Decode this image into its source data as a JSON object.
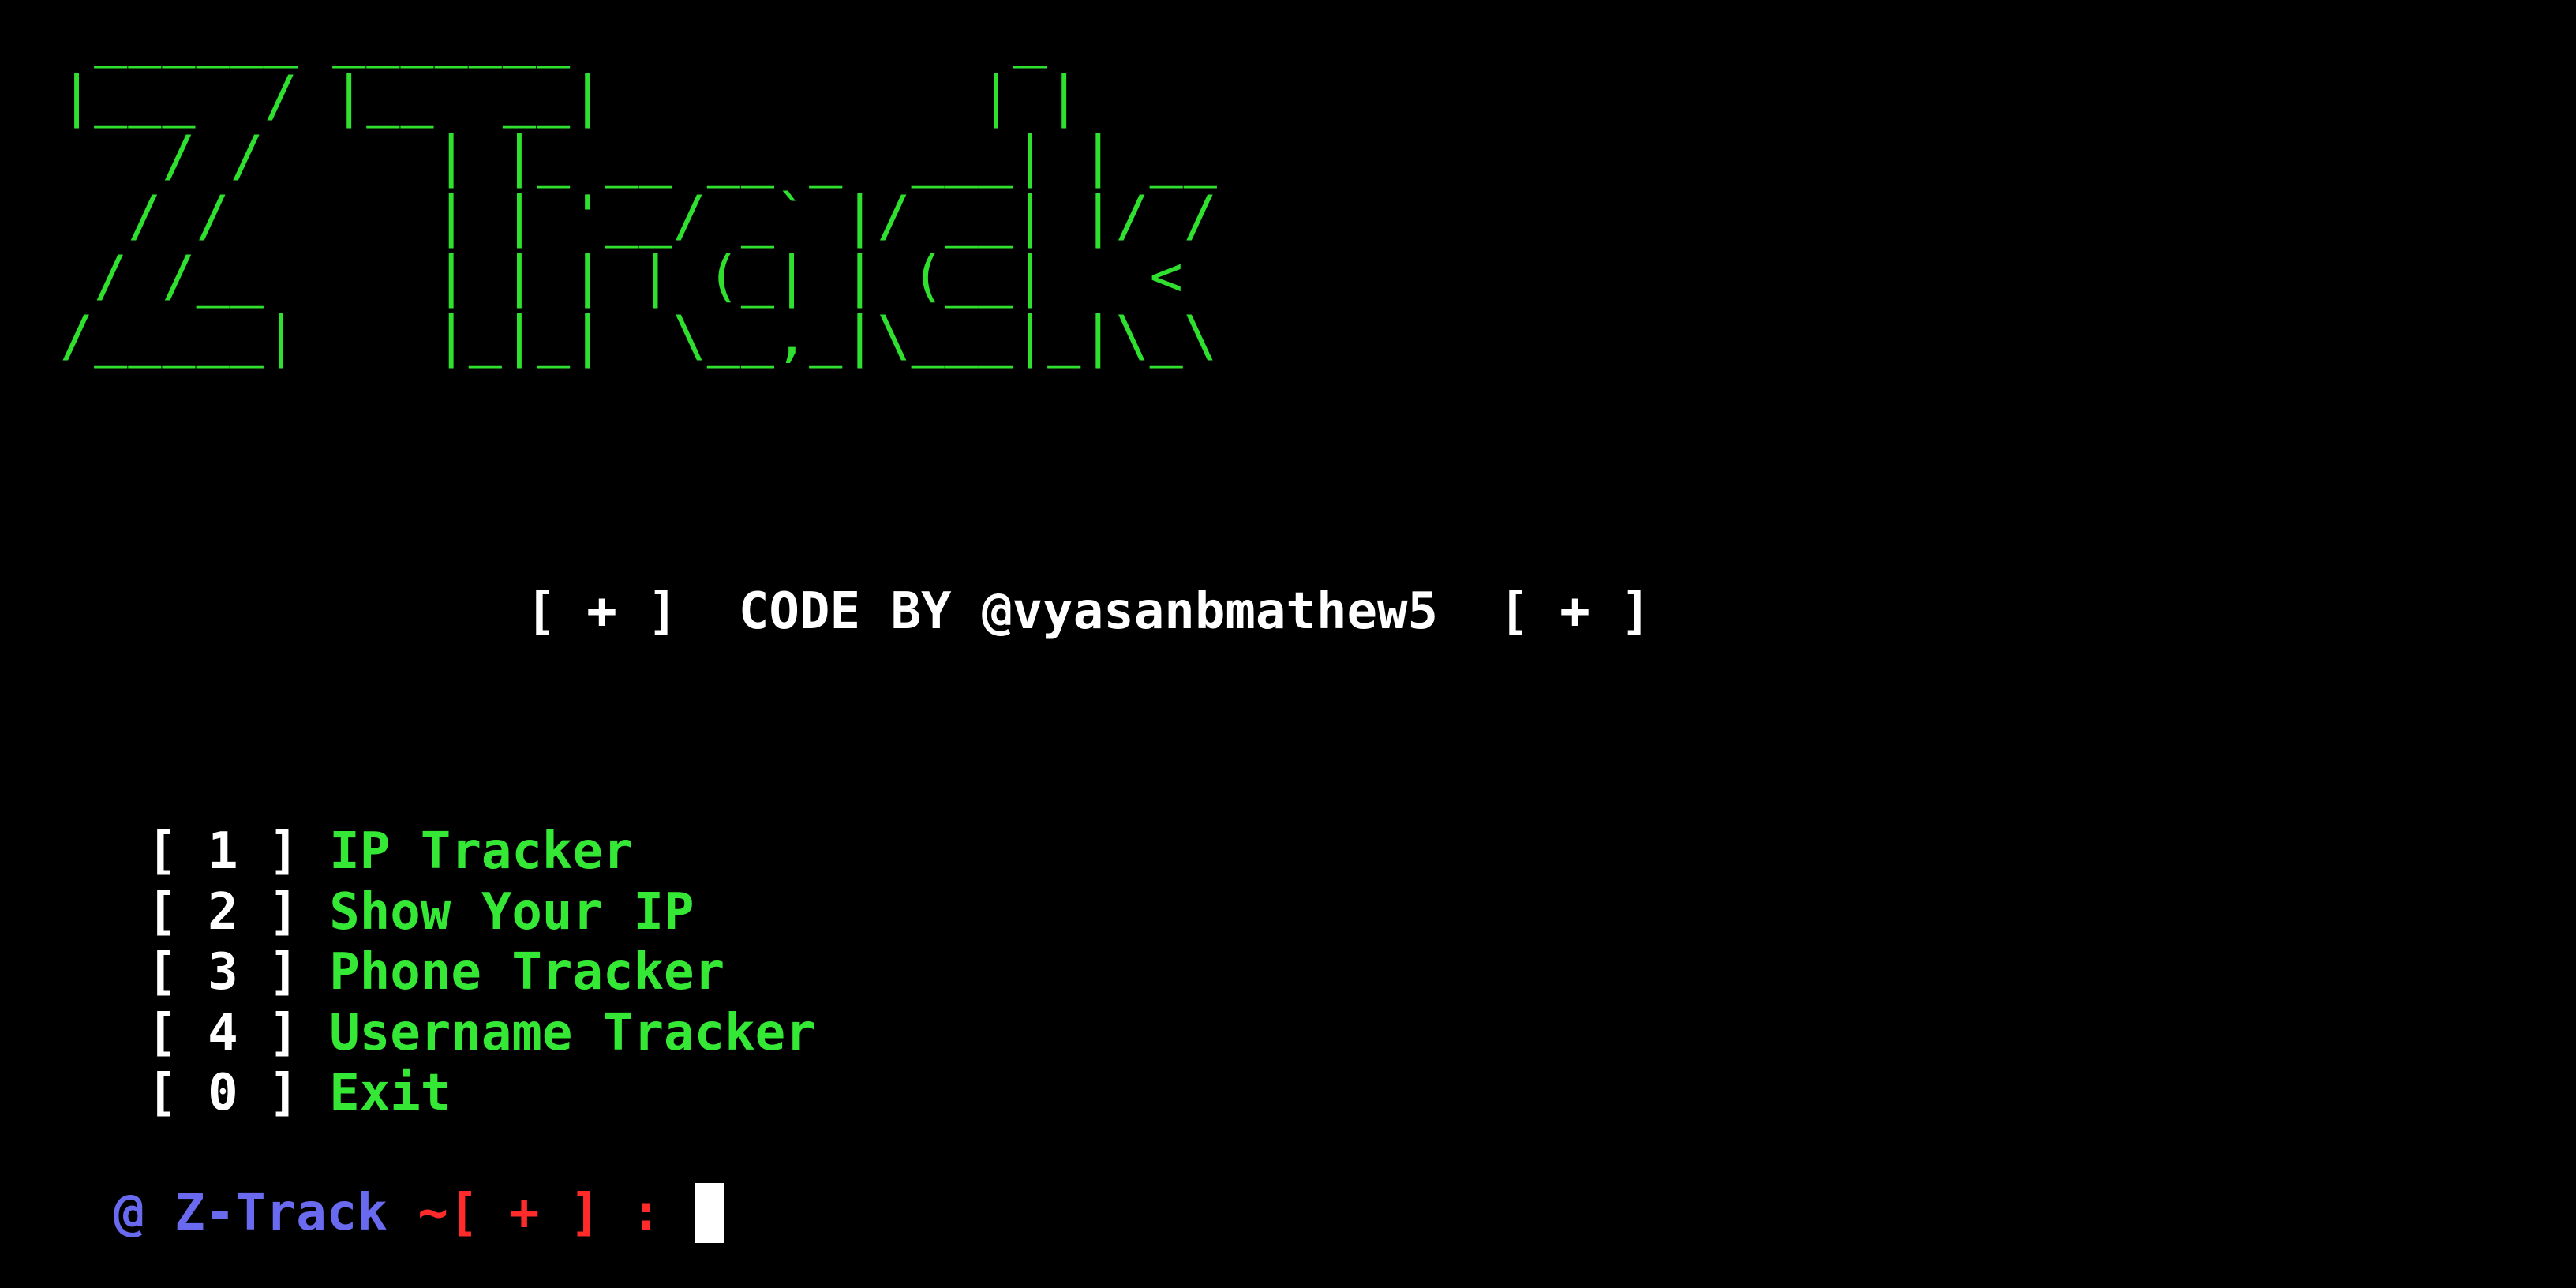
{
  "colors": {
    "background": "#000000",
    "banner": "#2fe02f",
    "bracket": "#ffffff",
    "menu_label": "#35e835",
    "prompt_user": "#6a6af0",
    "prompt_tilde": "#ff2a2a",
    "cursor": "#ffffff"
  },
  "banner": {
    "ascii_art": " ______ _______             _    \n|___  / |__  __|           | |   \n   / /     | |_ __ __ _  ___| | __\n  / /      | | '__/ _` |/ __| |/ /\n / /__     | | | | (_| | (__|   < \n/_____|    |_|_|  \\__,_|\\___|_|\\_\\"
  },
  "credit": {
    "left_marker": "[ + ]",
    "text": "CODE BY @vyasanbmathew5",
    "right_marker": "[ + ]"
  },
  "menu": {
    "items": [
      {
        "key": "[ 1 ]",
        "label": "IP Tracker"
      },
      {
        "key": "[ 2 ]",
        "label": "Show Your IP"
      },
      {
        "key": "[ 3 ]",
        "label": "Phone Tracker"
      },
      {
        "key": "[ 4 ]",
        "label": "Username Tracker"
      },
      {
        "key": "[ 0 ]",
        "label": "Exit"
      }
    ]
  },
  "prompt": {
    "user": "@ Z-Track",
    "tilde": "~[ + ] :",
    "input_value": ""
  }
}
